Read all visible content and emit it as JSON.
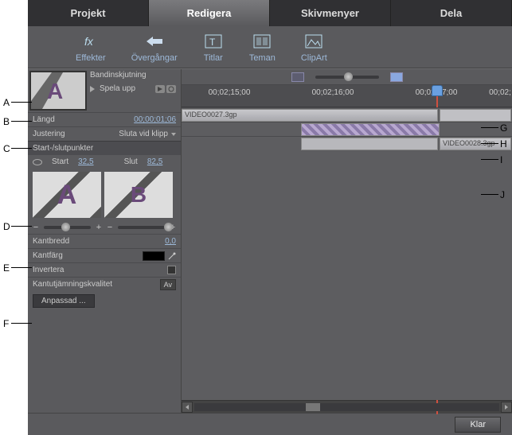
{
  "tabs": {
    "projekt": "Projekt",
    "redigera": "Redigera",
    "skivmenyer": "Skivmenyer",
    "dela": "Dela"
  },
  "toolbar": {
    "effekter": "Effekter",
    "overgangar": "Övergångar",
    "titlar": "Titlar",
    "teman": "Teman",
    "clipart": "ClipArt"
  },
  "panel": {
    "bandinskjutning": "Bandinskjutning",
    "spela_upp": "Spela upp",
    "langd_label": "Längd",
    "langd_value": "00;00;01;06",
    "justering_label": "Justering",
    "justering_value": "Sluta vid klipp",
    "start_slut_header": "Start-/slutpunkter",
    "start_label": "Start",
    "start_value": "32,5",
    "slut_label": "Slut",
    "slut_value": "82,5",
    "kantbredd_label": "Kantbredd",
    "kantbredd_value": "0,0",
    "kantfarg_label": "Kantfärg",
    "invertera_label": "Invertera",
    "kantutj_label": "Kantutjämningskvalitet",
    "kantutj_value": "Av",
    "anpassad_btn": "Anpassad ..."
  },
  "timeline": {
    "ticks": [
      "00;02;15;00",
      "00;02;16;00",
      "00;02;17;00",
      "00;02;"
    ],
    "clip_a": "VIDEO0027.3gp",
    "clip_b": "VIDEO0028.3gp"
  },
  "footer": {
    "klar": "Klar"
  },
  "annotations": {
    "A": "A",
    "B": "B",
    "C": "C",
    "D": "D",
    "E": "E",
    "F": "F",
    "G": "G",
    "H": "H",
    "I": "I",
    "J": "J"
  }
}
